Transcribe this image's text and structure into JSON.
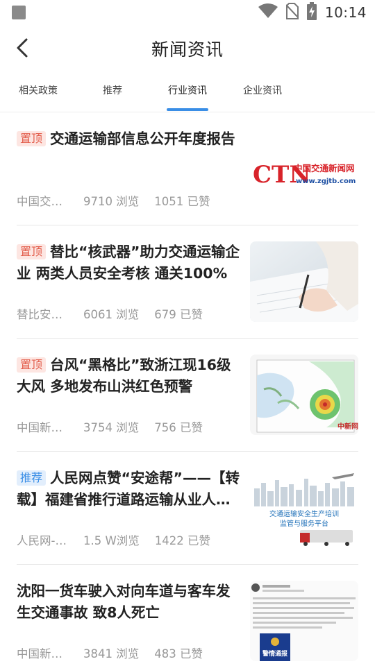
{
  "status_bar": {
    "time": "10:14",
    "icons": [
      "notification-square-icon",
      "wifi-icon",
      "no-sim-icon",
      "battery-charging-icon"
    ]
  },
  "header": {
    "title": "新闻资讯",
    "back_icon": "back-arrow-icon"
  },
  "tabs": [
    {
      "label": "相关政策",
      "active": false
    },
    {
      "label": "推荐",
      "active": false
    },
    {
      "label": "行业资讯",
      "active": true
    },
    {
      "label": "企业资讯",
      "active": false
    }
  ],
  "colors": {
    "accent": "#3a8ee6",
    "pin_badge": "#e25c4a",
    "pin_badge_bg": "#fde6e2",
    "rec_badge": "#3a8ee6",
    "rec_badge_bg": "#e2eefc",
    "meta_text": "#999999"
  },
  "news": [
    {
      "badge": "置顶",
      "badge_type": "pin",
      "title": "交通运输部信息公开年度报告",
      "source": "中国交…",
      "views": "9710 浏览",
      "likes": "1051 已赞",
      "thumb": {
        "type": "logo",
        "logo_text": "CTN",
        "logo_cn": "中国交通新闻网",
        "logo_url": "www.zgjtb.com"
      }
    },
    {
      "badge": "置顶",
      "badge_type": "pin",
      "title": "替比“核武器”助力交通运输企业 两类人员安全考核 通关100%",
      "source": "替比安…",
      "views": "6061 浏览",
      "likes": "679 已赞",
      "thumb": {
        "type": "photo",
        "description_icon": "writing-hand-photo"
      }
    },
    {
      "badge": "置顶",
      "badge_type": "pin",
      "title": "台风“黑格比”致浙江现16级大风 多地发布山洪红色预警",
      "source": "中国新…",
      "views": "3754 浏览",
      "likes": "756 已赞",
      "thumb": {
        "type": "radar",
        "watermark": "中新网"
      }
    },
    {
      "badge": "推荐",
      "badge_type": "rec",
      "title": "人民网点赞“安途帮”——【转载】福建省推行道路运输从业人…",
      "source": "人民网-…",
      "views": "1.5 W浏览",
      "likes": "1422 已赞",
      "thumb": {
        "type": "banner",
        "line1": "交通运输安全生产培训",
        "line2": "监管与服务平台"
      }
    },
    {
      "badge": "",
      "badge_type": "none",
      "title": "沈阳一货车驶入对向车道与客车发生交通事故 致8人死亡",
      "source": "中国新…",
      "views": "3841 浏览",
      "likes": "483 已赞",
      "thumb": {
        "type": "screenshot",
        "stamp_text": "警情通报"
      }
    }
  ]
}
